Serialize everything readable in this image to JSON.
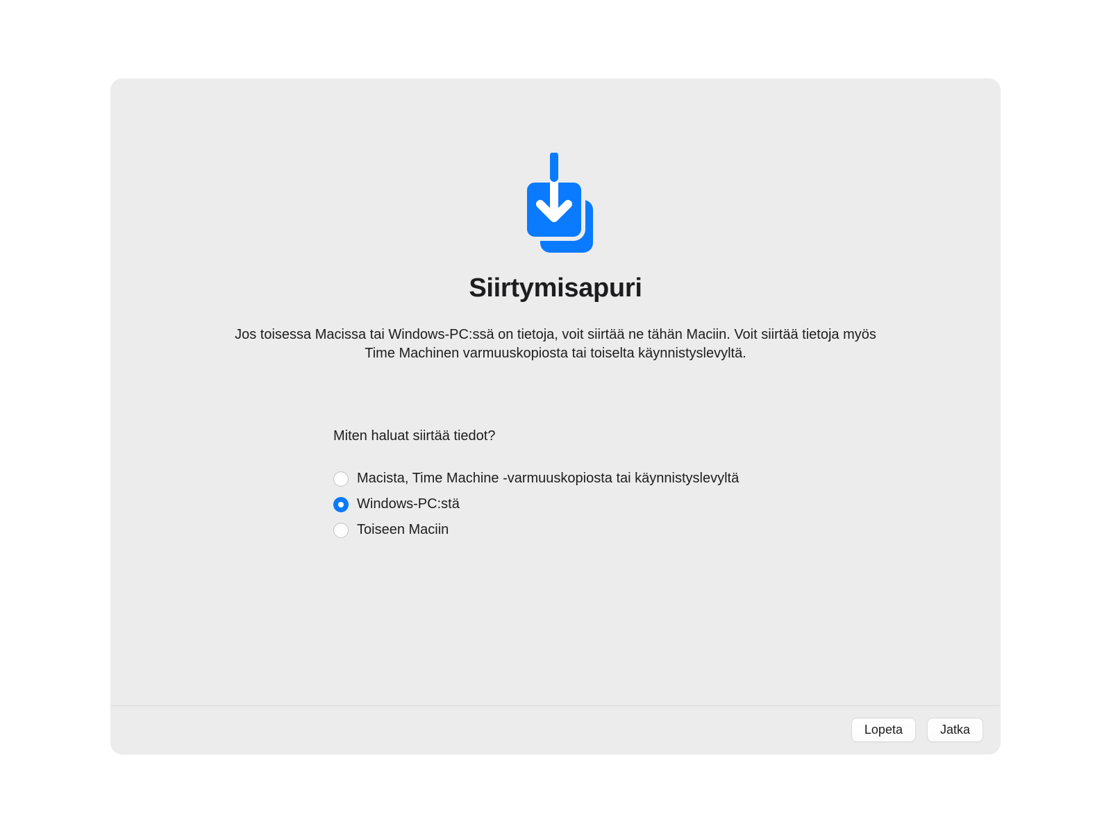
{
  "header": {
    "title": "Siirtymisapuri",
    "description": "Jos toisessa Macissa tai Windows-PC:ssä on tietoja, voit siirtää ne tähän Maciin. Voit siirtää tietoja myös Time Machinen varmuuskopiosta tai toiselta käynnistyslevyltä."
  },
  "form": {
    "question": "Miten haluat siirtää tiedot?",
    "options": [
      {
        "label": "Macista, Time Machine -varmuuskopiosta tai käynnistyslevyltä",
        "selected": false
      },
      {
        "label": "Windows-PC:stä",
        "selected": true
      },
      {
        "label": "Toiseen Maciin",
        "selected": false
      }
    ]
  },
  "footer": {
    "quit_label": "Lopeta",
    "continue_label": "Jatka"
  },
  "colors": {
    "accent": "#0a7aff"
  }
}
